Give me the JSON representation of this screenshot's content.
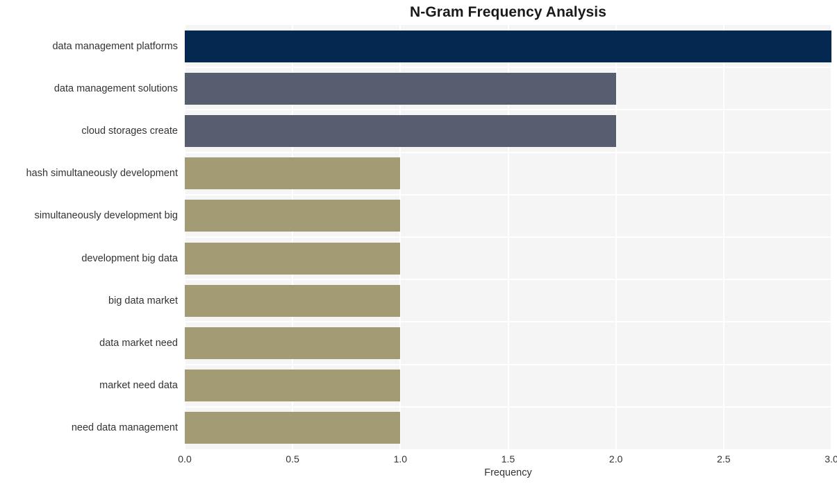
{
  "chart_data": {
    "type": "bar",
    "orientation": "horizontal",
    "title": "N-Gram Frequency Analysis",
    "xlabel": "Frequency",
    "ylabel": "",
    "xlim": [
      0.0,
      3.0
    ],
    "xticks": [
      "0.0",
      "0.5",
      "1.0",
      "1.5",
      "2.0",
      "2.5",
      "3.0"
    ],
    "xtick_values": [
      0.0,
      0.5,
      1.0,
      1.5,
      2.0,
      2.5,
      3.0
    ],
    "grid": "white gridlines on light gray plot background",
    "legend": "none",
    "categories": [
      "data management platforms",
      "data management solutions",
      "cloud storages create",
      "hash simultaneously development",
      "simultaneously development big",
      "development big data",
      "big data market",
      "data market need",
      "market need data",
      "need data management"
    ],
    "values": [
      3,
      2,
      2,
      1,
      1,
      1,
      1,
      1,
      1,
      1
    ],
    "bar_colors": [
      "#042850",
      "#585e70",
      "#585e70",
      "#a39b74",
      "#a39b74",
      "#a39b74",
      "#a39b74",
      "#a39b74",
      "#a39b74",
      "#a39b74"
    ]
  },
  "style": {
    "plot_background": "#f5f5f6",
    "figure_background": "#ffffff",
    "gridline_color": "#ffffff",
    "text_color": "#333333",
    "title_color": "#1a1a1a"
  }
}
